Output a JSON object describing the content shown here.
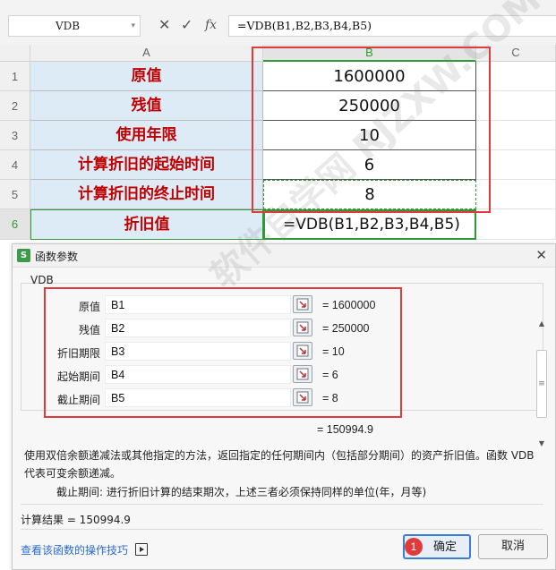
{
  "formula_bar": {
    "name_box": "VDB",
    "cancel_glyph": "✕",
    "confirm_glyph": "✓",
    "fx_label": "fx",
    "formula": "=VDB(B1,B2,B3,B4,B5)"
  },
  "columns": [
    "A",
    "B",
    "C"
  ],
  "rows": [
    {
      "num": "1",
      "label": "原值",
      "value": "1600000"
    },
    {
      "num": "2",
      "label": "残值",
      "value": "250000"
    },
    {
      "num": "3",
      "label": "使用年限",
      "value": "10"
    },
    {
      "num": "4",
      "label": "计算折旧的起始时间",
      "value": "6"
    },
    {
      "num": "5",
      "label": "计算折旧的终止时间",
      "value": "8"
    },
    {
      "num": "6",
      "label": "折旧值",
      "value": "=VDB(B1,B2,B3,B4,B5)"
    }
  ],
  "dialog": {
    "title": "函数参数",
    "logo": "S",
    "close_glyph": "✕",
    "function_name": "VDB",
    "args": [
      {
        "label": "原值",
        "input": "B1",
        "result": "=  1600000"
      },
      {
        "label": "残值",
        "input": "B2",
        "result": "=  250000"
      },
      {
        "label": "折旧期限",
        "input": "B3",
        "result": "=  10"
      },
      {
        "label": "起始期间",
        "input": "B4",
        "result": "=  6"
      },
      {
        "label": "截止期间",
        "input": "B5",
        "result": "=  8"
      }
    ],
    "formula_result": "=  150994.9",
    "description": "使用双倍余额递减法或其他指定的方法，返回指定的任何期间内（包括部分期间）的资产折旧值。函数 VDB 代表可变余额递减。",
    "param_description": "截止期间:  进行折旧计算的结束期次，上述三者必须保持同样的单位(年，月等)",
    "calc_result": "计算结果  =  150994.9",
    "tips_link": "查看该函数的操作技巧",
    "ok_label": "确定",
    "cancel_label": "取消",
    "badge": "1"
  },
  "watermark": "软件自学网 RJZXW.COM",
  "colors": {
    "label_text": "#c00000",
    "label_bg": "#ddebf7",
    "highlight_box": "#e03b3b",
    "selection": "#2e9a34",
    "link": "#2a6bd1"
  }
}
